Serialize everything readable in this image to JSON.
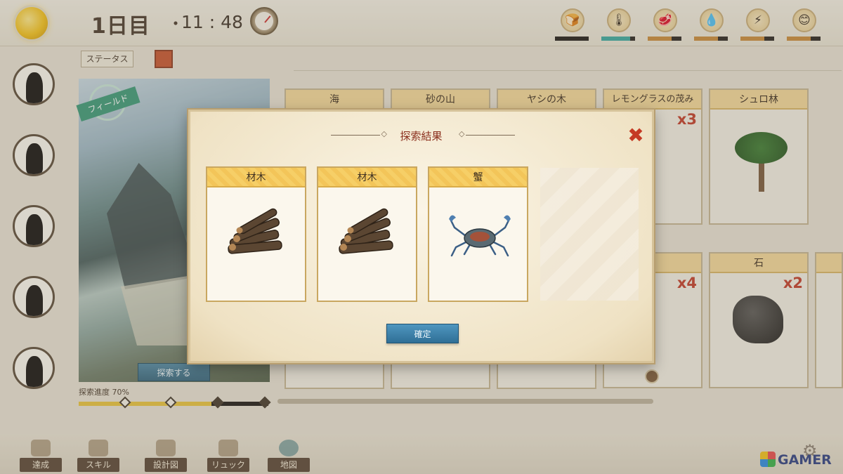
{
  "hud": {
    "day": "1日目",
    "separator": "・",
    "time": "11 : 48",
    "stats": [
      {
        "icon": "bread-icon",
        "glyph": "🍞",
        "level": 1.0,
        "color": "#1f1b18"
      },
      {
        "icon": "thermometer-icon",
        "glyph": "🌡",
        "level": 0.85,
        "color": "#3aa9a0"
      },
      {
        "icon": "meat-icon",
        "glyph": "🥩",
        "level": 0.7,
        "color": "#c98a3a"
      },
      {
        "icon": "water-drop-icon",
        "glyph": "💧",
        "level": 0.7,
        "color": "#c98a3a"
      },
      {
        "icon": "lightning-icon",
        "glyph": "⚡",
        "level": 0.7,
        "color": "#c98a3a"
      },
      {
        "icon": "smile-icon",
        "glyph": "😊",
        "level": 0.7,
        "color": "#c98a3a"
      }
    ]
  },
  "left": {
    "status_tab": "ステータス",
    "field_badge": "フィールド",
    "explore_button": "探索する",
    "progress_label": "探索進度 70%",
    "progress": 0.7
  },
  "background_cards": {
    "row1": [
      {
        "name": "海"
      },
      {
        "name": "砂の山"
      },
      {
        "name": "ヤシの木"
      },
      {
        "name": "レモングラスの茂み",
        "count": "x3"
      },
      {
        "name": "シュロ林"
      }
    ],
    "row2": [
      {
        "name": "",
        "count": "x4"
      },
      {
        "name": "石",
        "count": "x2"
      }
    ]
  },
  "modal": {
    "title": "探索結果",
    "results": [
      {
        "name": "材木",
        "icon": "lumber-icon"
      },
      {
        "name": "材木",
        "icon": "lumber-icon"
      },
      {
        "name": "蟹",
        "icon": "crab-icon"
      }
    ],
    "confirm_button": "確定"
  },
  "bottom_nav": [
    "達成",
    "スキル",
    "設計図",
    "リュック",
    "地図"
  ],
  "watermark": "GAMER"
}
